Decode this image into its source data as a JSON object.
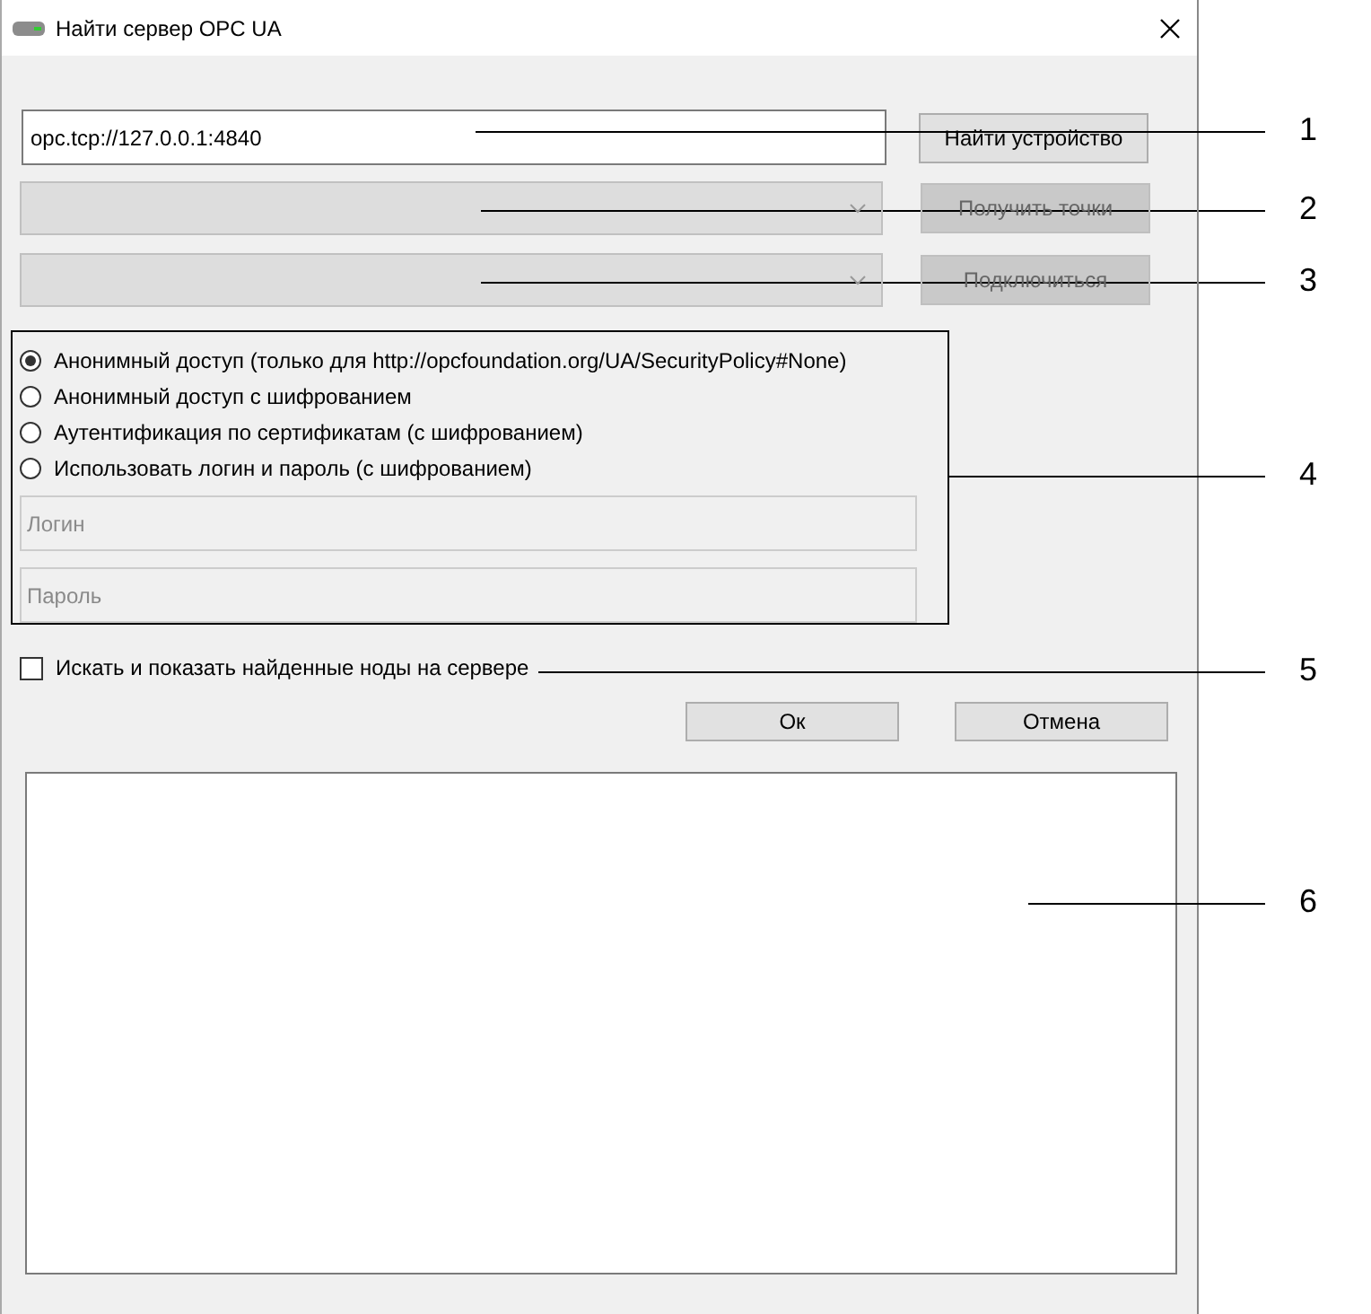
{
  "window": {
    "title": "Найти сервер OPC UA"
  },
  "url_field": {
    "value": "opc.tcp://127.0.0.1:4840"
  },
  "find_button": {
    "label": "Найти устройство",
    "disabled": false
  },
  "dropdowns": [
    {
      "button": "Получить точки",
      "disabled": true
    },
    {
      "button": "Подключиться",
      "disabled": true
    }
  ],
  "auth_options": [
    {
      "label": "Анонимный доступ (только для http://opcfoundation.org/UA/SecurityPolicy#None)",
      "selected": true
    },
    {
      "label": "Анонимный доступ с шифрованием",
      "selected": false
    },
    {
      "label": "Аутентификация по сертификатам (с шифрованием)",
      "selected": false
    },
    {
      "label": "Использовать логин и пароль (с шифрованием)",
      "selected": false
    }
  ],
  "credentials": [
    {
      "placeholder": "Логин",
      "disabled": true
    },
    {
      "placeholder": "Пароль",
      "disabled": true
    }
  ],
  "search_nodes": {
    "label": "Искать и показать найденные ноды на сервере",
    "checked": false
  },
  "buttons": [
    {
      "label": "Ок"
    },
    {
      "label": "Отмена"
    }
  ],
  "callouts": [
    {
      "number": "1"
    },
    {
      "number": "2"
    },
    {
      "number": "3"
    },
    {
      "number": "4"
    },
    {
      "number": "5"
    },
    {
      "number": "6"
    }
  ]
}
